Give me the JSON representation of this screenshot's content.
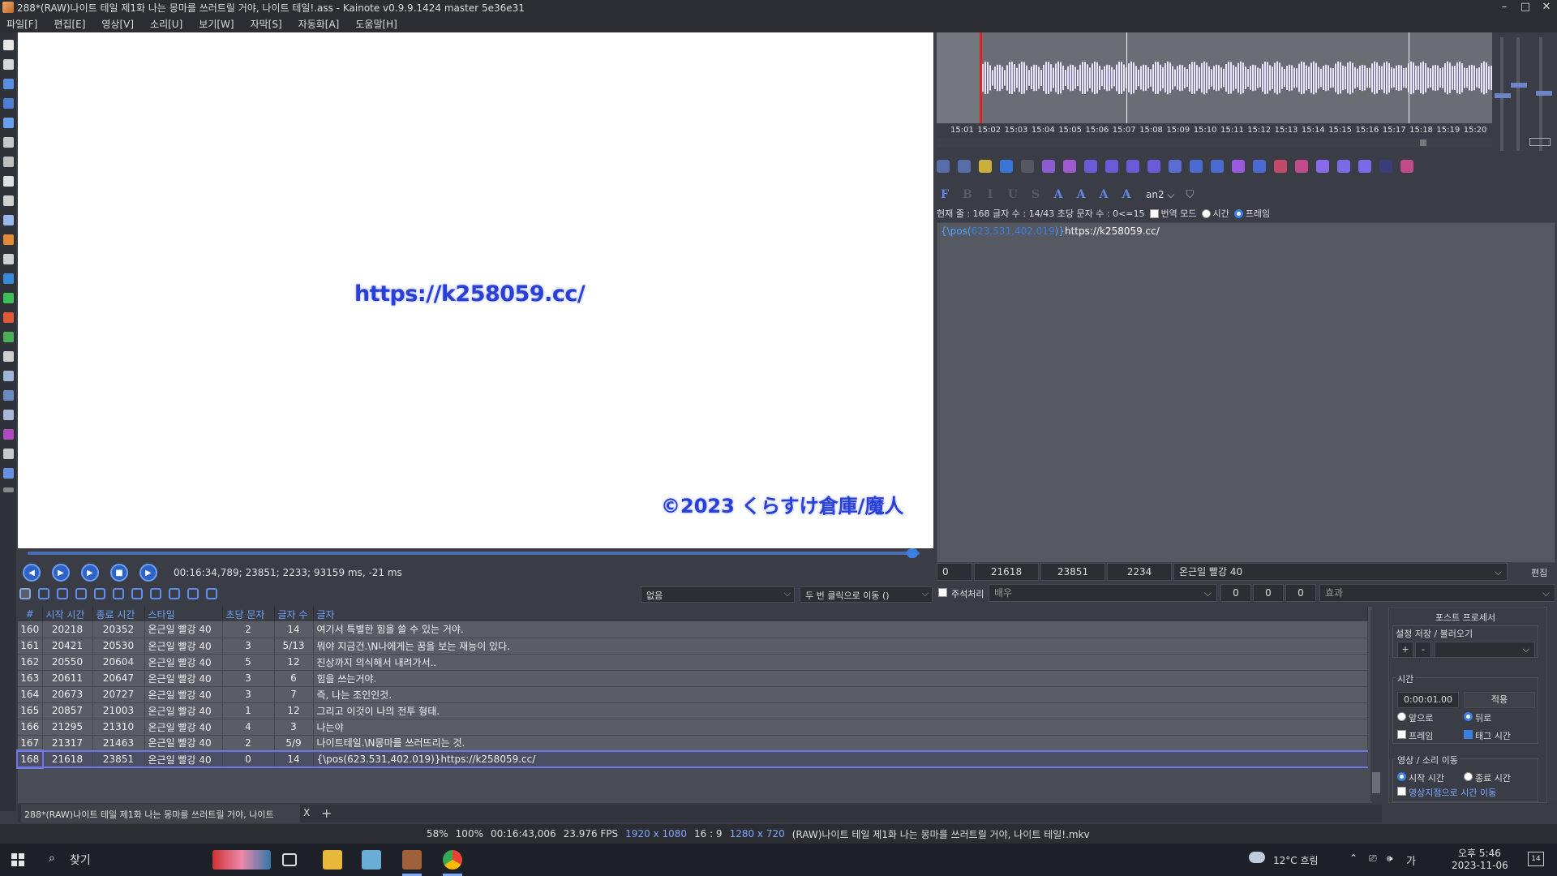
{
  "window": {
    "title": "288*(RAW)나이트 테일 제1화 나는 몽마를 쓰러트릴 거야, 나이트 테일!.ass - Kainote v0.9.9.1424  master 5e36e31",
    "controls": [
      "–",
      "□",
      "✕"
    ]
  },
  "menu": [
    "파일[F]",
    "편집[E]",
    "영상[V]",
    "소리[U]",
    "보기[W]",
    "자막[S]",
    "자동화[A]",
    "도움말[H]"
  ],
  "video": {
    "subtitle_url": "https://k258059.cc/",
    "subtitle_copyright": "©2023  くらすけ倉庫/魔人",
    "time_info": "00:16:34,789;  23851;  2233;  93159 ms, -21 ms",
    "progress_fraction": 0.99
  },
  "video_tools": {
    "combo_none": "없음",
    "combo_move": "두 번 클릭으로 이동 ()"
  },
  "grid": {
    "headers": [
      "#",
      "시작 시간",
      "종료 시간",
      "스타일",
      "초당 문자",
      "글자 수",
      "글자"
    ],
    "rows": [
      {
        "num": "160",
        "start": "20218",
        "end": "20352",
        "style": "온근일 빨강 40",
        "cps": "2",
        "chars": "14",
        "text": "여기서 특별한 힘을 쓸 수 있는 거야."
      },
      {
        "num": "161",
        "start": "20421",
        "end": "20530",
        "style": "온근일 빨강 40",
        "cps": "3",
        "chars": "5/13",
        "text": "뭐야 지금건.\\N나에게는 꿈을 보는 재능이 있다."
      },
      {
        "num": "162",
        "start": "20550",
        "end": "20604",
        "style": "온근일 빨강 40",
        "cps": "5",
        "chars": "12",
        "text": "진상까지 의식해서 내려가서.."
      },
      {
        "num": "163",
        "start": "20611",
        "end": "20647",
        "style": "온근일 빨강 40",
        "cps": "3",
        "chars": "6",
        "text": "힘을 쓰는거야."
      },
      {
        "num": "164",
        "start": "20673",
        "end": "20727",
        "style": "온근일 빨강 40",
        "cps": "3",
        "chars": "7",
        "text": "즉, 나는 조인인것."
      },
      {
        "num": "165",
        "start": "20857",
        "end": "21003",
        "style": "온근일 빨강 40",
        "cps": "1",
        "chars": "12",
        "text": "그리고 이것이 나의 전투 형태."
      },
      {
        "num": "166",
        "start": "21295",
        "end": "21310",
        "style": "온근일 빨강 40",
        "cps": "4",
        "chars": "3",
        "text": "나는야"
      },
      {
        "num": "167",
        "start": "21317",
        "end": "21463",
        "style": "온근일 빨강 40",
        "cps": "2",
        "chars": "5/9",
        "text": "나이트테일.\\N몽마를 쓰러뜨리는 것."
      },
      {
        "num": "168",
        "start": "21618",
        "end": "23851",
        "style": "온근일 빨강 40",
        "cps": "0",
        "chars": "14",
        "text": "{\\pos(623.531,402.019)}https://k258059.cc/"
      }
    ],
    "active_row": "168"
  },
  "tabs": {
    "active": "288*(RAW)나이트 테일 제1화 나는 몽마를 쓰러트릴 거야, 나이트",
    "close": "X",
    "add": "+"
  },
  "status": {
    "zoom1": "58%",
    "zoom2": "100%",
    "duration": "00:16:43,006",
    "fps": "23.976 FPS",
    "resolution": "1920 x 1080",
    "aspect": "16 : 9",
    "script_res": "1280 x 720",
    "filename": "(RAW)나이트 테일 제1화 나는 몽마를 쓰러트릴 거야, 나이트 테일!.mkv"
  },
  "audio": {
    "time_labels": [
      "15:01",
      "15:02",
      "15:03",
      "15:04",
      "15:05",
      "15:06",
      "15:07",
      "15:08",
      "15:09",
      "15:10",
      "15:11",
      "15:12",
      "15:13",
      "15:14",
      "15:15",
      "15:16",
      "15:17",
      "15:18",
      "15:19",
      "15:20"
    ]
  },
  "editor": {
    "format_buttons": [
      "F",
      "B",
      "I",
      "U",
      "S",
      "A",
      "A",
      "A",
      "A"
    ],
    "anchor": "an2",
    "info": "현재 줄 : 168  글자 수 : 14/43  초당 문자 수 : 0<=15",
    "translation_mode": "번역 모드",
    "time_radio": "시간",
    "frame_radio": "프레임",
    "tag_part": "{\\pos(",
    "pos_values": "623.531,402.019",
    "tag_close": ")}",
    "text_part": "https://k258059.cc/",
    "layer": "0",
    "start": "21618",
    "end": "23851",
    "duration": "2234",
    "style": "온근일 빨강 40",
    "edit_label": "편집",
    "comment_label": "주석처리",
    "actor_placeholder": "배우",
    "margin_l": "0",
    "margin_r": "0",
    "margin_v": "0",
    "effect_placeholder": "효과"
  },
  "postproc": {
    "title": "포스트 프로세서",
    "preset_label": "설정 저장 / 불러오기",
    "plus": "+",
    "minus": "-",
    "time_group": "시간",
    "time_value": "0:00:01.00",
    "apply": "적용",
    "forward": "앞으로",
    "backward": "뒤로",
    "frame": "프레임",
    "tag_time": "태그 시간",
    "move_group": "영상 / 소리 이동",
    "start_time": "시작 시간",
    "end_time": "종료 시간",
    "move_to_video": "영상지점으로 시간 이동"
  },
  "taskbar": {
    "search": "찾기",
    "weather": "12°C  흐림",
    "ime": "가",
    "time": "오후 5:46",
    "date": "2023-11-06",
    "notif": "14"
  }
}
